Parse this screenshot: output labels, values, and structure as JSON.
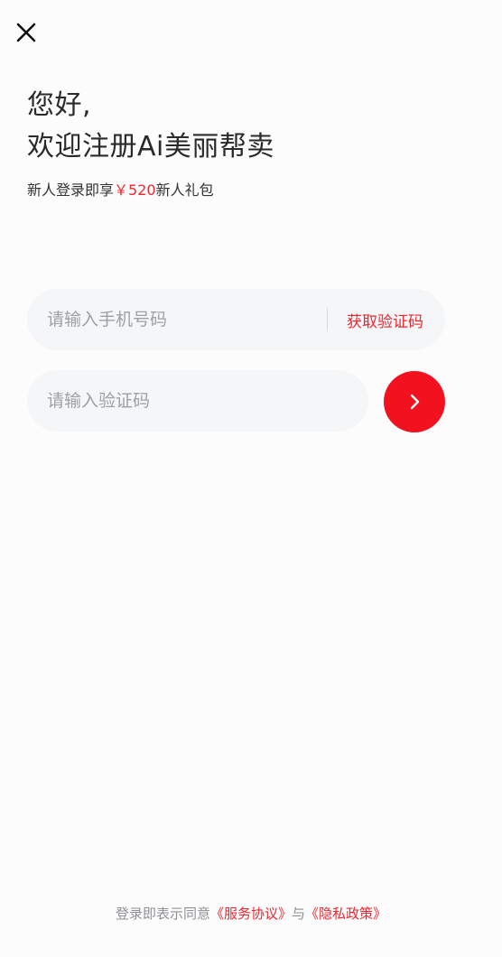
{
  "header": {
    "close_icon": "close-icon"
  },
  "greeting": {
    "line1": "您好,",
    "line2": "欢迎注册Ai美丽帮卖"
  },
  "promo": {
    "prefix": "新人登录即享",
    "amount": "￥520",
    "suffix": "新人礼包",
    "accent_color": "#f0262e"
  },
  "phone_field": {
    "placeholder": "请输入手机号码",
    "value": "",
    "get_code_label": "获取验证码"
  },
  "code_field": {
    "placeholder": "请输入验证码",
    "value": ""
  },
  "submit": {
    "icon": "chevron-right-icon",
    "color": "#f2121f"
  },
  "agreement": {
    "prefix": "登录即表示同意",
    "service_link": "《服务协议》",
    "connector": "与",
    "privacy_link": "《隐私政策》"
  }
}
